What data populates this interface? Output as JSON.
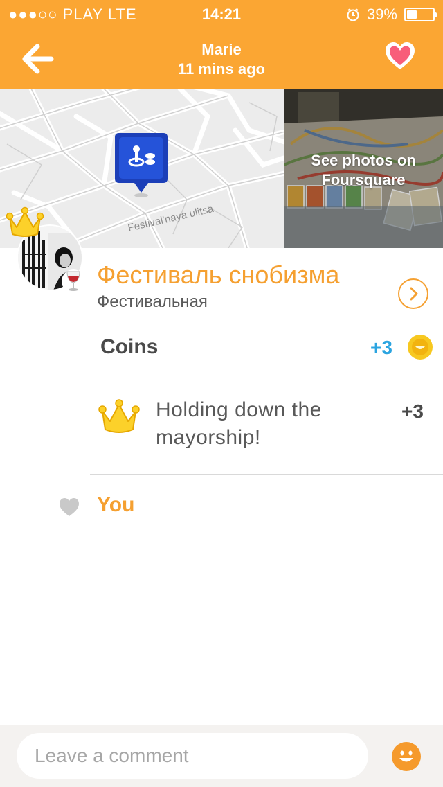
{
  "status_bar": {
    "carrier": "●●●○○ PLAY   LTE",
    "time": "14:21",
    "battery": "39%",
    "battery_level": 0.39
  },
  "header": {
    "name": "Marie",
    "time_ago": "11 mins ago"
  },
  "map": {
    "street_label": "Festival'naya ulitsa"
  },
  "photos": {
    "label_line1": "See photos on",
    "label_line2": "Foursquare"
  },
  "venue": {
    "name": "Фестиваль снобизма",
    "subtitle": "Фестивальная"
  },
  "coins": {
    "label": "Coins",
    "value": "+3"
  },
  "mayorship": {
    "text": "Holding down the mayorship!",
    "points": "+3"
  },
  "likes": {
    "name": "You"
  },
  "comment": {
    "placeholder": "Leave a comment"
  },
  "colors": {
    "brand": "#fba633",
    "accent_text": "#f5a031",
    "coins_blue": "#2ba4e0"
  }
}
